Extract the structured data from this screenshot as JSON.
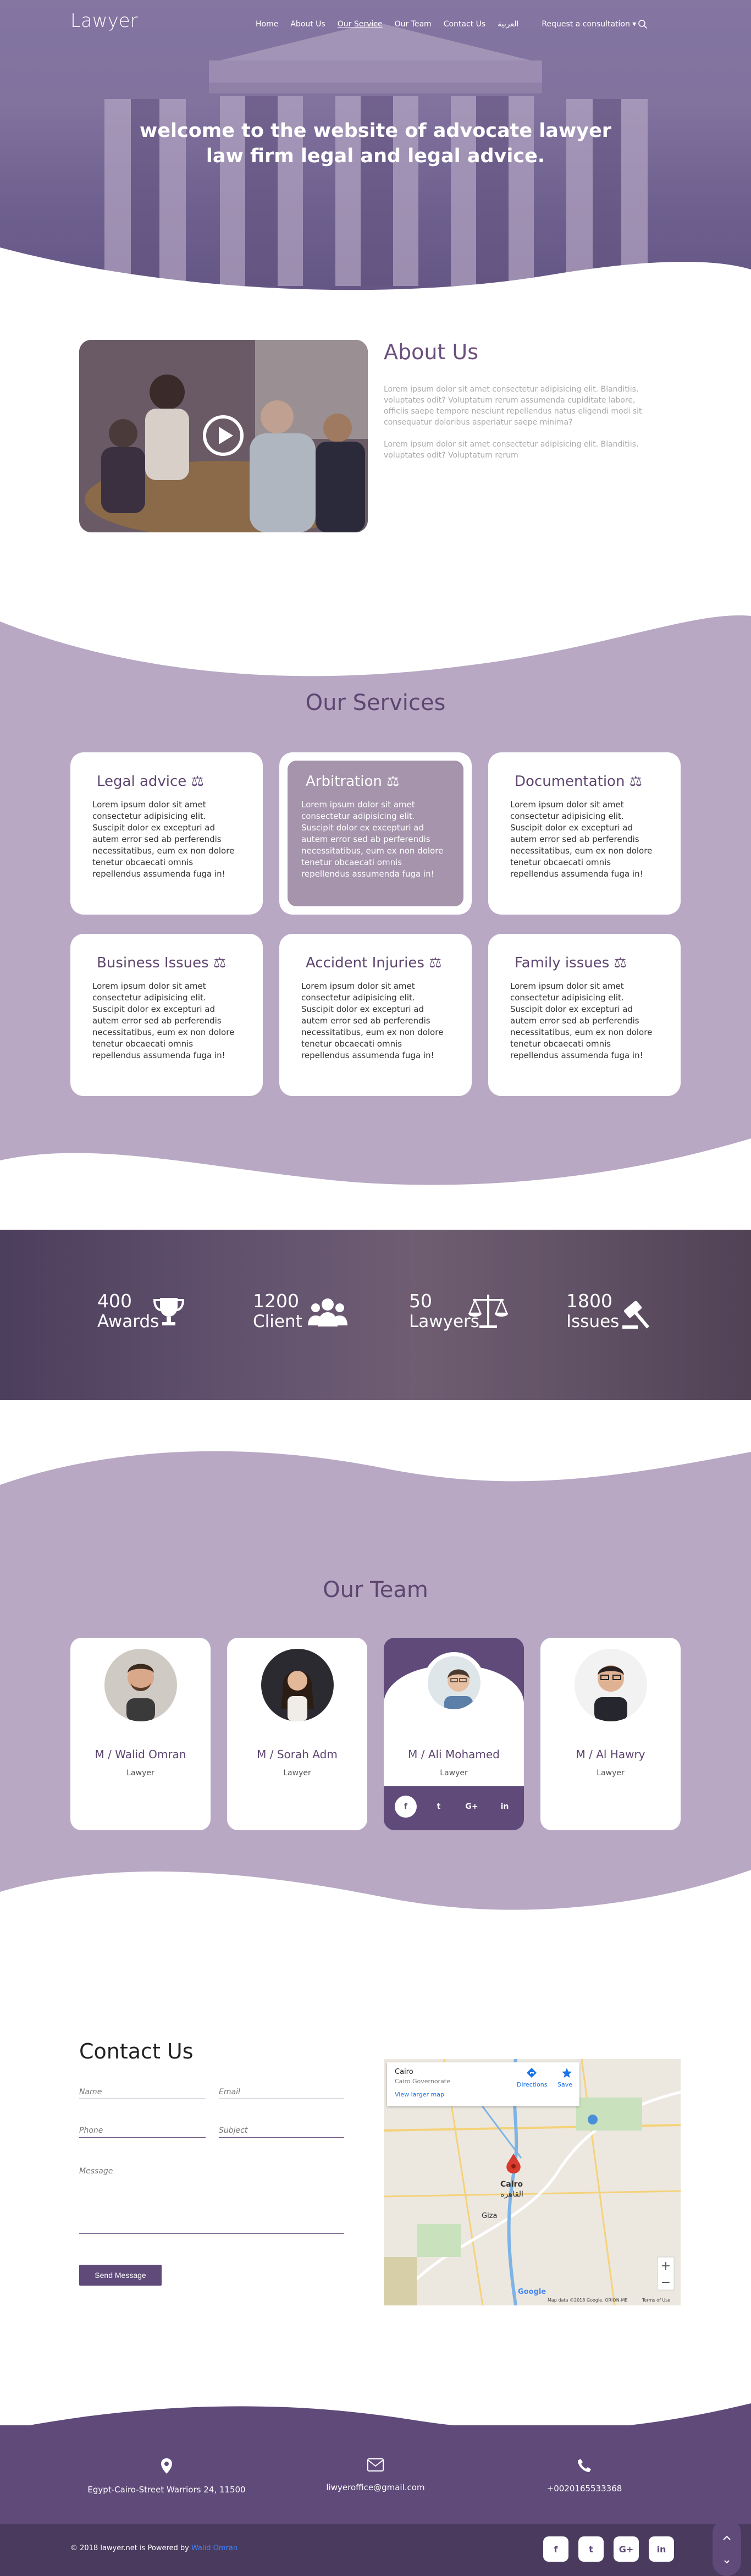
{
  "nav": {
    "logo": "Lawyer",
    "items": [
      "Home",
      "About Us",
      "Our Service",
      "Our Team",
      "Contact Us",
      "العربية"
    ],
    "request": "Request a consultation ▾"
  },
  "hero": {
    "line1": "welcome to the website of advocate lawyer",
    "line2": "law firm legal and legal advice."
  },
  "about": {
    "title": "About Us",
    "p1": "Lorem ipsum dolor sit amet consectetur adipisicing elit. Blanditiis, voluptates odit? Voluptatum rerum assumenda cupiditate labore, officiis saepe tempore nesciunt repellendus natus eligendi modi sit consequatur doloribus asperiatur saepe minima?",
    "p2": "Lorem ipsum dolor sit amet consectetur adipisicing elit. Blanditiis, voluptates odit? Voluptatum rerum"
  },
  "services": {
    "title": "Our Services",
    "body": "Lorem ipsum dolor sit amet consectetur adipisicing elit. Suscipit dolor ex excepturi ad autem error sed ab perferendis necessitatibus, eum ex non dolore tenetur obcaecati omnis repellendus assumenda fuga in!",
    "cards": [
      {
        "title": "Legal advice ⚖"
      },
      {
        "title": "Arbitration ⚖"
      },
      {
        "title": "Documentation ⚖"
      },
      {
        "title": "Business Issues ⚖"
      },
      {
        "title": "Accident Injuries ⚖"
      },
      {
        "title": "Family issues ⚖"
      }
    ]
  },
  "stats": [
    {
      "num": "400",
      "label": "Awards",
      "icon": "trophy-icon"
    },
    {
      "num": "1200",
      "label": "Client",
      "icon": "users-icon"
    },
    {
      "num": "50",
      "label": "Lawyers",
      "icon": "scale-icon"
    },
    {
      "num": "1800",
      "label": "Issues",
      "icon": "gavel-icon"
    }
  ],
  "team": {
    "title": "Our Team",
    "members": [
      {
        "name": "M / Walid Omran",
        "role": "Lawyer"
      },
      {
        "name": "M / Sorah Adm",
        "role": "Lawyer"
      },
      {
        "name": "M / Ali Mohamed",
        "role": "Lawyer"
      },
      {
        "name": "M / Al Hawry",
        "role": "Lawyer"
      }
    ],
    "socials": [
      "f",
      "t",
      "G+",
      "in"
    ]
  },
  "contact": {
    "title": "Contact Us",
    "name": "Name",
    "email": "Email",
    "phone": "Phone",
    "subject": "Subject",
    "message": "Message",
    "send": "Send Message"
  },
  "map": {
    "place": "Cairo",
    "sub": "Cairo Governorate",
    "larger": "View larger map",
    "directions": "Directions",
    "save": "Save",
    "city_en": "Cairo",
    "city_ar": "القاهرة",
    "giza": "Giza",
    "footer": "Map data ©2018 Google, ORION-ME",
    "terms": "Terms of Use",
    "google": "Google"
  },
  "footer": {
    "address": "Egypt-Cairo-Street Warriors 24, 11500",
    "email": "liwyeroffice@gmail.com",
    "phone": "+0020165533368",
    "copy": "© 2018 lawyer.net is Powered by",
    "powered": "Walid Omran",
    "socials": [
      "f",
      "t",
      "G+",
      "in"
    ]
  },
  "colors": {
    "purple": "#5f4a7a",
    "lilac": "#b8a8c4"
  }
}
